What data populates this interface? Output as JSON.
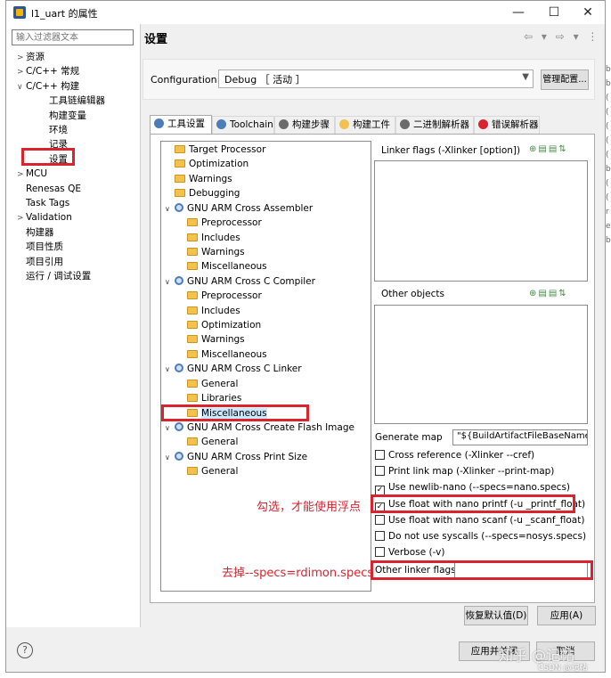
{
  "window": {
    "title": "l1_uart 的属性",
    "min": "—",
    "max": "☐",
    "close": "✕"
  },
  "left": {
    "filter_placeholder": "输入过滤器文本",
    "items": [
      {
        "label": "资源",
        "chev": ">"
      },
      {
        "label": "C/C++ 常规",
        "chev": ">"
      },
      {
        "label": "C/C++ 构建",
        "chev": "∨"
      },
      {
        "label": "工具链编辑器",
        "chev": ""
      },
      {
        "label": "构建变量",
        "chev": ""
      },
      {
        "label": "环境",
        "chev": ""
      },
      {
        "label": "记录",
        "chev": ""
      },
      {
        "label": "设置",
        "chev": ""
      },
      {
        "label": "MCU",
        "chev": ">"
      },
      {
        "label": "Renesas QE",
        "chev": ""
      },
      {
        "label": "Task Tags",
        "chev": ""
      },
      {
        "label": "Validation",
        "chev": ">"
      },
      {
        "label": "构建器",
        "chev": ""
      },
      {
        "label": "项目性质",
        "chev": ""
      },
      {
        "label": "项目引用",
        "chev": ""
      },
      {
        "label": "运行 / 调试设置",
        "chev": ""
      }
    ]
  },
  "header": {
    "title": "设置",
    "nav_icons": "⇦ ▾ ⇨ ▾ ⋮"
  },
  "config": {
    "label": "Configuration:",
    "value": "Debug ［ 活动 ］",
    "manage": "管理配置..."
  },
  "tabs": [
    {
      "label": "工具设置",
      "color": "#4b7db8"
    },
    {
      "label": "Toolchain",
      "color": "#4b7db8"
    },
    {
      "label": "构建步骤",
      "color": "#6b6b6b"
    },
    {
      "label": "构建工件",
      "color": "#f2c14e"
    },
    {
      "label": "二进制解析器",
      "color": "#6b6b6b"
    },
    {
      "label": "错误解析器",
      "color": "#d9232e"
    }
  ],
  "tree": [
    {
      "label": "Target Processor",
      "icon": "folder",
      "chev": ""
    },
    {
      "label": "Optimization",
      "icon": "folder",
      "chev": ""
    },
    {
      "label": "Warnings",
      "icon": "folder",
      "chev": ""
    },
    {
      "label": "Debugging",
      "icon": "folder",
      "chev": ""
    },
    {
      "label": "GNU ARM Cross Assembler",
      "icon": "gear",
      "chev": "∨"
    },
    {
      "label": "Preprocessor",
      "icon": "folder",
      "chev": ""
    },
    {
      "label": "Includes",
      "icon": "folder",
      "chev": ""
    },
    {
      "label": "Warnings",
      "icon": "folder",
      "chev": ""
    },
    {
      "label": "Miscellaneous",
      "icon": "folder",
      "chev": ""
    },
    {
      "label": "GNU ARM Cross C Compiler",
      "icon": "gear",
      "chev": "∨"
    },
    {
      "label": "Preprocessor",
      "icon": "folder",
      "chev": ""
    },
    {
      "label": "Includes",
      "icon": "folder",
      "chev": ""
    },
    {
      "label": "Optimization",
      "icon": "folder",
      "chev": ""
    },
    {
      "label": "Warnings",
      "icon": "folder",
      "chev": ""
    },
    {
      "label": "Miscellaneous",
      "icon": "folder",
      "chev": ""
    },
    {
      "label": "GNU ARM Cross C Linker",
      "icon": "gear",
      "chev": "∨"
    },
    {
      "label": "General",
      "icon": "folder",
      "chev": ""
    },
    {
      "label": "Libraries",
      "icon": "folder",
      "chev": ""
    },
    {
      "label": "Miscellaneous",
      "icon": "folder",
      "chev": "",
      "selected": true
    },
    {
      "label": "GNU ARM Cross Create Flash Image",
      "icon": "gear",
      "chev": "∨"
    },
    {
      "label": "General",
      "icon": "folder",
      "chev": ""
    },
    {
      "label": "GNU ARM Cross Print Size",
      "icon": "gear",
      "chev": "∨"
    },
    {
      "label": "General",
      "icon": "folder",
      "chev": ""
    }
  ],
  "pane": {
    "linker_flags": "Linker flags (-Xlinker [option])",
    "other_objects": "Other objects",
    "generate_map_label": "Generate map",
    "generate_map_value": "\"${BuildArtifactFileBaseName}.m",
    "checkboxes": [
      {
        "label": "Cross reference (-Xlinker --cref)",
        "checked": false
      },
      {
        "label": "Print link map (-Xlinker --print-map)",
        "checked": false
      },
      {
        "label": "Use newlib-nano (--specs=nano.specs)",
        "checked": true
      },
      {
        "label": "Use float with nano printf (-u _printf_float)",
        "checked": true
      },
      {
        "label": "Use float with nano scanf (-u _scanf_float)",
        "checked": false
      },
      {
        "label": "Do not use syscalls (--specs=nosys.specs)",
        "checked": false
      },
      {
        "label": "Verbose (-v)",
        "checked": false
      }
    ],
    "other_linker_flags": "Other linker flags"
  },
  "buttons": {
    "restore": "恢复默认值(D)",
    "apply": "应用(A)",
    "apply_close": "应用并关闭",
    "cancel": "取消"
  },
  "annotations": {
    "check_note": "勾选，才能使用浮点",
    "remove_note": "去掉--specs=rdimon.specs",
    "color": "#d9232e"
  },
  "watermark": {
    "main": "知乎 @记帖",
    "sub": "CSDN @记帖"
  },
  "bg_strip": [
    "b",
    "b",
    "(",
    "(",
    "(",
    "(",
    "(",
    "b",
    "(",
    "(",
    "r",
    "e",
    "b"
  ]
}
